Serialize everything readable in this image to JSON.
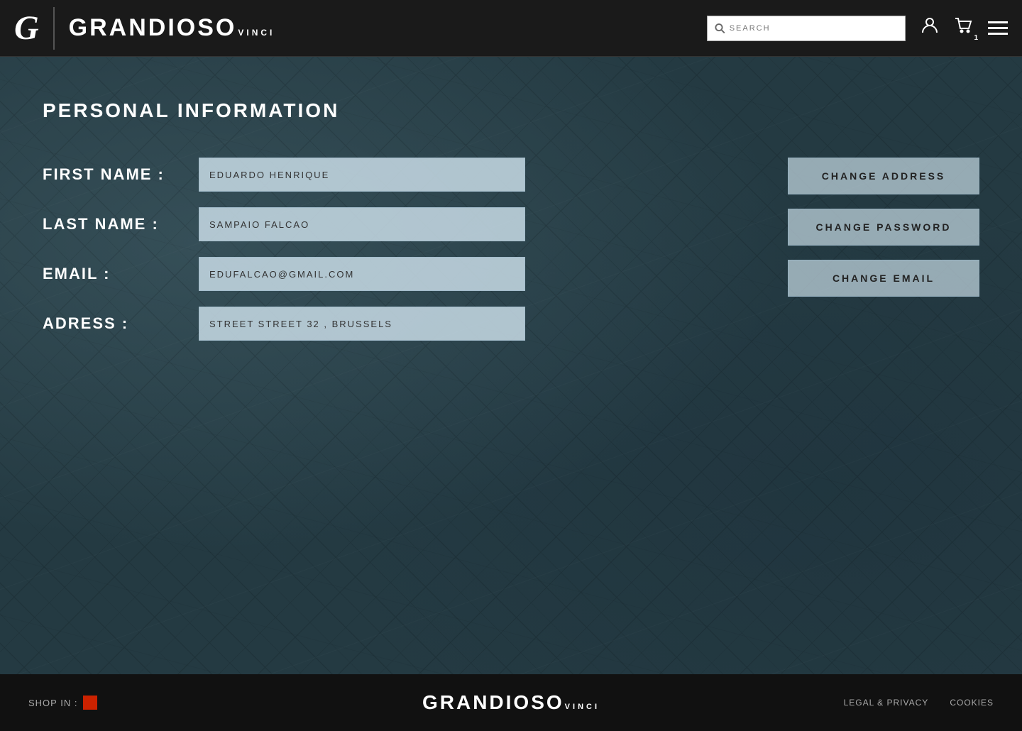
{
  "header": {
    "logo_g": "G",
    "brand_main": "GRANDIOSO",
    "brand_sub": "VINCI",
    "search_placeholder": "SEARCH",
    "cart_badge": "1",
    "menu_label": "menu"
  },
  "page": {
    "section_title": "PERSONAL INFORMATION",
    "fields": [
      {
        "label": "FIRST NAME :",
        "value": "EDUARDO HENRIQUE"
      },
      {
        "label": "LAST NAME :",
        "value": "SAMPAIO FALCAO"
      },
      {
        "label": "EMAIL :",
        "value": "EDUFALCAO@GMAIL.COM"
      },
      {
        "label": "ADRESS :",
        "value": "STREET STREET 32 , BRUSSELS"
      }
    ],
    "actions": [
      {
        "label": "CHANGE ADDRESS"
      },
      {
        "label": "CHANGE PASSWORD"
      },
      {
        "label": "CHANGE EMAIL"
      }
    ]
  },
  "footer": {
    "shop_label": "SHOP IN :",
    "brand_main": "GRANDIOSO",
    "brand_sub": "VINCI",
    "links": [
      {
        "label": "LEGAL & PRIVACY"
      },
      {
        "label": "COOKIES"
      }
    ]
  }
}
